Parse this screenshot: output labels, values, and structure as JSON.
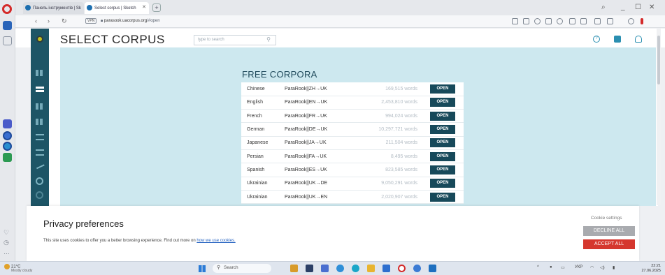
{
  "browser": {
    "tabs": [
      {
        "label": "Панель інструментів | Sk"
      },
      {
        "label": "Select corpus | Sketch"
      }
    ],
    "url_domain": "parasook.uacorpus.org",
    "url_path": "/#open",
    "vpn_label": "VPN"
  },
  "header": {
    "title": "SELECT CORPUS",
    "search_placeholder": "type to search"
  },
  "corpora": {
    "title": "FREE CORPORA",
    "open_label": "OPEN",
    "rows": [
      {
        "lang": "Chinese",
        "corpus": "ParaRook||ZH→UK",
        "words": "169,515 words"
      },
      {
        "lang": "English",
        "corpus": "ParaRook||EN→UK",
        "words": "2,453,810 words"
      },
      {
        "lang": "French",
        "corpus": "ParaRook||FR→UK",
        "words": "994,024 words"
      },
      {
        "lang": "German",
        "corpus": "ParaRook||DE→UK",
        "words": "10,297,721 words"
      },
      {
        "lang": "Japanese",
        "corpus": "ParaRook||JA→UK",
        "words": "211,504 words"
      },
      {
        "lang": "Persian",
        "corpus": "ParaRook||FA→UK",
        "words": "8,495 words"
      },
      {
        "lang": "Spanish",
        "corpus": "ParaRook||ES→UK",
        "words": "823,585 words"
      },
      {
        "lang": "Ukrainian",
        "corpus": "ParaRook||UK→DE",
        "words": "9,050,291 words"
      },
      {
        "lang": "Ukrainian",
        "corpus": "ParaRook||UK→EN",
        "words": "2,020,907 words"
      }
    ]
  },
  "cookie": {
    "title": "Privacy preferences",
    "text": "This site uses cookies to offer you a better browsing experience. Find out more on ",
    "link": "how we use cookies.",
    "settings": "Cookie settings",
    "decline": "DECLINE ALL",
    "accept": "ACCEPT ALL"
  },
  "taskbar": {
    "weather_temp": "21°C",
    "weather_desc": "Mostly cloudy",
    "search": "Search",
    "time": "22:21",
    "date": "27.06.2025"
  },
  "colors": {
    "accent_dark": "#17495a",
    "panel_bg": "#cde8ef",
    "accept": "#d5372e",
    "decline": "#a9abaf"
  }
}
